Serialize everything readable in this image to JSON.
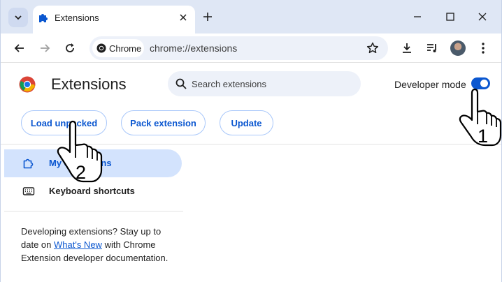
{
  "tab": {
    "title": "Extensions"
  },
  "toolbar": {
    "chip_label": "Chrome",
    "url": "chrome://extensions"
  },
  "page": {
    "title": "Extensions",
    "search_placeholder": "Search extensions",
    "developer_mode_label": "Developer mode",
    "developer_mode_on": true
  },
  "actions": {
    "load_unpacked": "Load unpacked",
    "pack_extension": "Pack extension",
    "update": "Update"
  },
  "sidebar": {
    "items": [
      {
        "label": "My extensions",
        "active": true,
        "icon": "puzzle-icon"
      },
      {
        "label": "Keyboard shortcuts",
        "active": false,
        "icon": "keyboard-icon"
      }
    ],
    "note_before": "Developing extensions? Stay up to date on ",
    "note_link": "What's New",
    "note_after": " with Chrome Extension developer documentation."
  },
  "annotations": {
    "step1": "1",
    "step2": "2"
  },
  "colors": {
    "accent": "#0b57d0",
    "active_bg": "#d3e3fd",
    "tabstrip_bg": "#dfe7f5",
    "omnibox_bg": "#edf1f9"
  }
}
